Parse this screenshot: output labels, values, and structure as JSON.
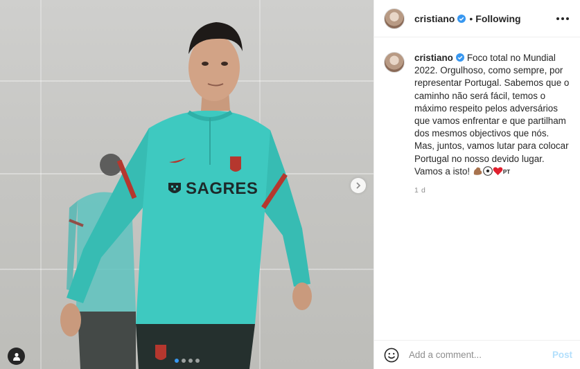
{
  "post": {
    "author": "cristiano",
    "verified": true,
    "follow_status": "Following",
    "bullet": "•"
  },
  "media": {
    "jersey_sponsor": "SAGRES",
    "carousel_count": 4,
    "carousel_active_index": 0,
    "icons": [
      "next-arrow-icon",
      "tag-people-icon",
      "carousel-dots"
    ]
  },
  "caption": {
    "username": "cristiano",
    "text": "Foco total no Mundial 2022. Orgulhoso, como sempre, por representar Portugal. Sabemos que o caminho não será fácil, temos o máximo respeito pelos adversários que vamos enfrentar e que partilham dos mesmos objectivos que nós. Mas, juntos, vamos lutar para colocar Portugal no nosso devido lugar. Vamos a isto!",
    "flag_text": "PT",
    "emojis": [
      "flexed-biceps-emoji",
      "soccer-ball-emoji",
      "red-heart-emoji",
      "portugal-flag-emoji"
    ],
    "timestamp": "1 d"
  },
  "comment": {
    "placeholder": "Add a comment...",
    "post_label": "Post"
  },
  "colors": {
    "verified_blue": "#3897f0",
    "post_disabled": "#b2dffc",
    "jersey": "#3ec9c0",
    "text": "#262626",
    "muted": "#8e8e8e"
  }
}
